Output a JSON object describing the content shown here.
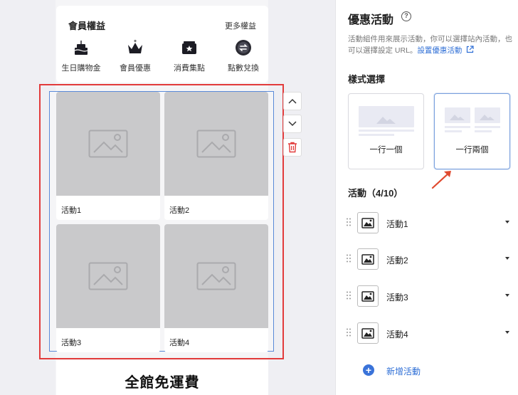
{
  "member": {
    "title": "會員權益",
    "more_label": "更多權益",
    "perks": [
      {
        "label": "生日購物金",
        "icon": "birthday-cake-icon"
      },
      {
        "label": "會員優惠",
        "icon": "crown-icon"
      },
      {
        "label": "消費集點",
        "icon": "stamp-card-icon"
      },
      {
        "label": "點數兌換",
        "icon": "exchange-icon"
      }
    ]
  },
  "preview": {
    "activities": [
      {
        "label": "活動1"
      },
      {
        "label": "活動2"
      },
      {
        "label": "活動3"
      },
      {
        "label": "活動4"
      }
    ],
    "free_shipping": "全館免運費"
  },
  "panel": {
    "title": "優惠活動",
    "help": "?",
    "description": "活動組件用來展示活動，你可以選擇站內活動，也可以選擇設定 URL。",
    "link_label": "設置優惠活動",
    "style_section": "樣式選擇",
    "style_options": [
      {
        "label": "一行一個",
        "selected": false
      },
      {
        "label": "一行兩個",
        "selected": true
      }
    ],
    "activities_section": "活動（4/10）",
    "activities": [
      {
        "label": "活動1"
      },
      {
        "label": "活動2"
      },
      {
        "label": "活動3"
      },
      {
        "label": "活動4"
      }
    ],
    "add_label": "新增活動"
  },
  "colors": {
    "accent": "#3a73d9",
    "selection_outline": "#e23b3b",
    "placeholder": "#c9c9cb"
  }
}
